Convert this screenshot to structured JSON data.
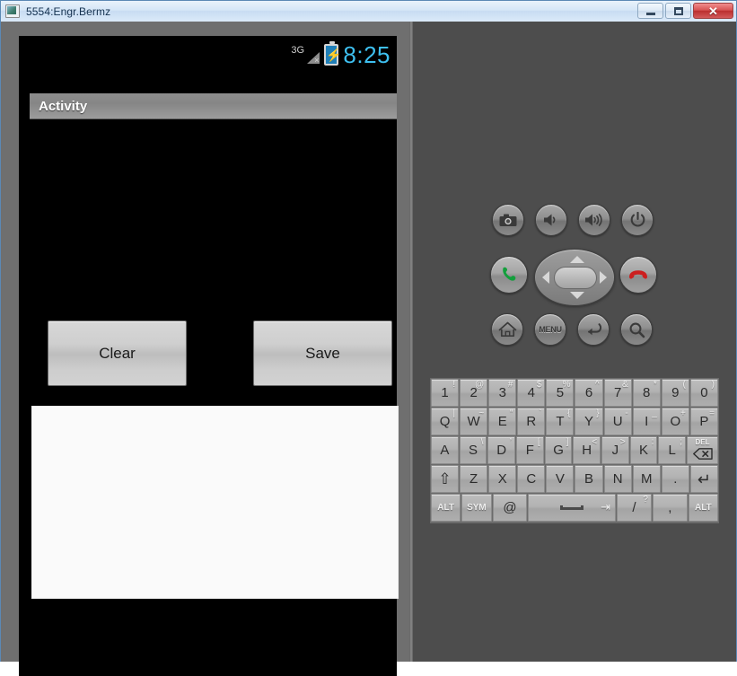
{
  "window": {
    "title": "5554:Engr.Bermz",
    "icon": "emulator-window-icon",
    "minimize_label": "Minimize",
    "maximize_label": "Maximize",
    "close_label": "✕"
  },
  "phone": {
    "status_bar": {
      "network_label": "3G",
      "network_state_mark": "×",
      "battery_glyph": "⚡",
      "time": "8:25",
      "time_color": "#3ec0f0"
    },
    "activity": {
      "title": "Activity"
    },
    "buttons": [
      {
        "name": "clear-button",
        "label": "Clear"
      },
      {
        "name": "save-button",
        "label": "Save"
      }
    ],
    "canvas": {
      "name": "signature-canvas",
      "content": ""
    }
  },
  "controls": {
    "hardware": [
      {
        "name": "camera-button",
        "icon": "camera-icon"
      },
      {
        "name": "volume-down-button",
        "icon": "volume-down-icon"
      },
      {
        "name": "volume-up-button",
        "icon": "volume-up-icon"
      },
      {
        "name": "power-button",
        "icon": "power-icon"
      }
    ],
    "call": {
      "name": "call-button",
      "icon": "phone-call-icon",
      "color": "#139f3c"
    },
    "end_call": {
      "name": "end-call-button",
      "icon": "phone-hangup-icon",
      "color": "#cc1f1f"
    },
    "dpad": {
      "name": "dpad",
      "up": "▲",
      "down": "▼",
      "left": "◀",
      "right": "▶",
      "center": "select"
    },
    "nav": [
      {
        "name": "home-button",
        "icon": "home-icon",
        "label": ""
      },
      {
        "name": "menu-button",
        "icon": "menu-icon",
        "label": "MENU"
      },
      {
        "name": "back-button",
        "icon": "back-arrow-icon",
        "label": ""
      },
      {
        "name": "search-button",
        "icon": "search-icon",
        "label": ""
      }
    ]
  },
  "keyboard": {
    "rows": [
      [
        {
          "main": "1",
          "alt": "!"
        },
        {
          "main": "2",
          "alt": "@"
        },
        {
          "main": "3",
          "alt": "#"
        },
        {
          "main": "4",
          "alt": "$"
        },
        {
          "main": "5",
          "alt": "%"
        },
        {
          "main": "6",
          "alt": "^"
        },
        {
          "main": "7",
          "alt": "&"
        },
        {
          "main": "8",
          "alt": "*"
        },
        {
          "main": "9",
          "alt": "("
        },
        {
          "main": "0",
          "alt": ")"
        }
      ],
      [
        {
          "main": "Q",
          "alt": "|"
        },
        {
          "main": "W",
          "alt": "~"
        },
        {
          "main": "E",
          "alt": "“"
        },
        {
          "main": "R",
          "alt": "`"
        },
        {
          "main": "T",
          "alt": "{"
        },
        {
          "main": "Y",
          "alt": "}"
        },
        {
          "main": "U",
          "alt": "-"
        },
        {
          "main": "I",
          "alt": "_"
        },
        {
          "main": "O",
          "alt": "+"
        },
        {
          "main": "P",
          "alt": "="
        }
      ],
      [
        {
          "main": "A",
          "alt": ""
        },
        {
          "main": "S",
          "alt": "\\"
        },
        {
          "main": "D",
          "alt": "’"
        },
        {
          "main": "F",
          "alt": "["
        },
        {
          "main": "G",
          "alt": "]"
        },
        {
          "main": "H",
          "alt": "<"
        },
        {
          "main": "J",
          "alt": ">"
        },
        {
          "main": "K",
          "alt": ":"
        },
        {
          "main": "L",
          "alt": ";"
        },
        {
          "main": "DEL",
          "alt": ""
        }
      ],
      [
        {
          "main": "⇧",
          "alt": ""
        },
        {
          "main": "Z",
          "alt": ""
        },
        {
          "main": "X",
          "alt": ""
        },
        {
          "main": "C",
          "alt": ""
        },
        {
          "main": "V",
          "alt": ""
        },
        {
          "main": "B",
          "alt": ""
        },
        {
          "main": "N",
          "alt": ""
        },
        {
          "main": "M",
          "alt": ""
        },
        {
          "main": ".",
          "alt": ""
        },
        {
          "main": "↵",
          "alt": ""
        }
      ],
      [
        {
          "main": "ALT",
          "alt": ""
        },
        {
          "main": "SYM",
          "alt": ""
        },
        {
          "main": "@",
          "alt": ""
        },
        {
          "main": "",
          "alt": ""
        },
        {
          "main": "/",
          "alt": "?"
        },
        {
          "main": ",",
          "alt": ""
        },
        {
          "main": "ALT",
          "alt": ""
        }
      ]
    ],
    "del_label": "DEL",
    "space_label": ""
  }
}
